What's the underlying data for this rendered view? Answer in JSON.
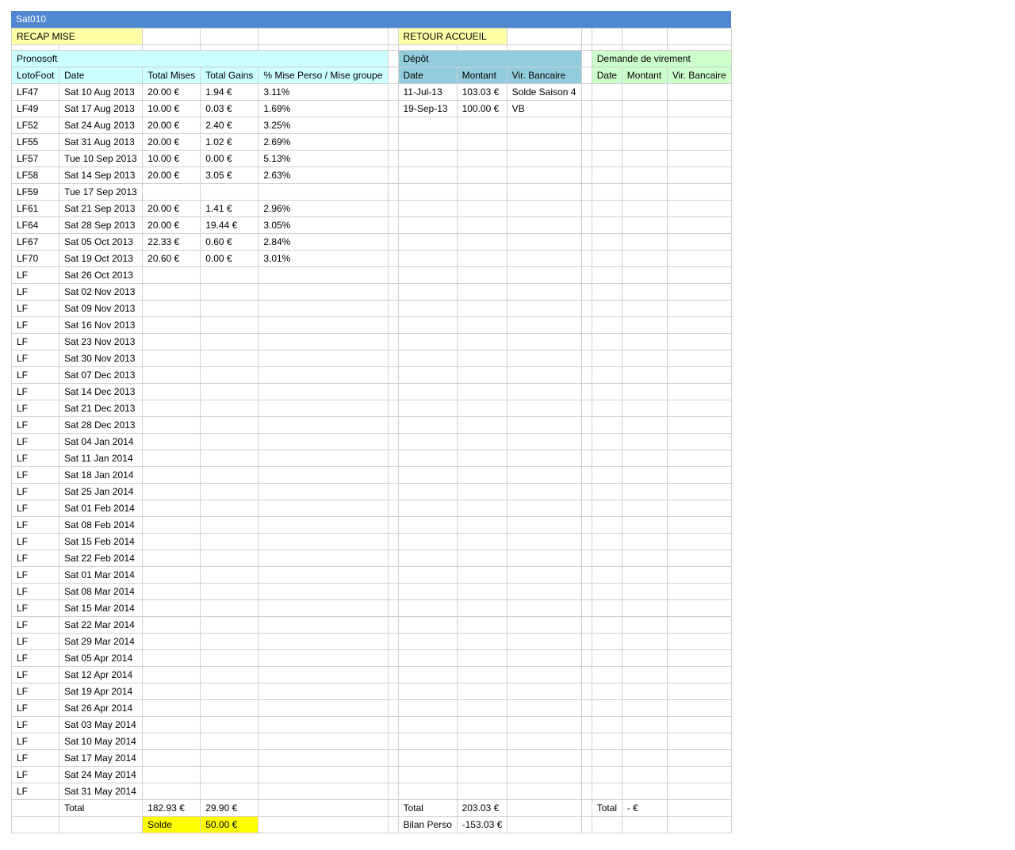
{
  "sheet_title": "Sat010",
  "buttons": {
    "recap_mise": "RECAP MISE",
    "retour_accueil": "RETOUR ACCUEIL"
  },
  "pronosoft": {
    "section_title": "Pronosoft",
    "headers": {
      "lotofoot": "LotoFoot",
      "date": "Date",
      "total_mises": "Total Mises",
      "total_gains": "Total Gains",
      "pct": "% Mise Perso / Mise groupe"
    },
    "rows": [
      [
        "LF47",
        "Sat 10 Aug 2013",
        "20.00 €",
        "1.94 €",
        "3.11%"
      ],
      [
        "LF49",
        "Sat 17 Aug 2013",
        "10.00 €",
        "0.03 €",
        "1.69%"
      ],
      [
        "LF52",
        "Sat 24 Aug 2013",
        "20.00 €",
        "2.40 €",
        "3.25%"
      ],
      [
        "LF55",
        "Sat 31 Aug 2013",
        "20.00 €",
        "1.02 €",
        "2.69%"
      ],
      [
        "LF57",
        "Tue 10 Sep 2013",
        "10.00 €",
        "0.00 €",
        "5.13%"
      ],
      [
        "LF58",
        "Sat 14 Sep 2013",
        "20.00 €",
        "3.05 €",
        "2.63%"
      ],
      [
        "LF59",
        "Tue 17 Sep 2013",
        "",
        "",
        ""
      ],
      [
        "LF61",
        "Sat 21 Sep 2013",
        "20.00 €",
        "1.41 €",
        "2.96%"
      ],
      [
        "LF64",
        "Sat 28 Sep 2013",
        "20.00 €",
        "19.44 €",
        "3.05%"
      ],
      [
        "LF67",
        "Sat 05 Oct 2013",
        "22.33 €",
        "0.60 €",
        "2.84%"
      ],
      [
        "LF70",
        "Sat 19 Oct 2013",
        "20.60 €",
        "0.00 €",
        "3.01%"
      ],
      [
        "LF",
        "Sat 26 Oct 2013",
        "",
        "",
        ""
      ],
      [
        "LF",
        "Sat 02 Nov 2013",
        "",
        "",
        ""
      ],
      [
        "LF",
        "Sat 09 Nov 2013",
        "",
        "",
        ""
      ],
      [
        "LF",
        "Sat 16 Nov 2013",
        "",
        "",
        ""
      ],
      [
        "LF",
        "Sat 23 Nov 2013",
        "",
        "",
        ""
      ],
      [
        "LF",
        "Sat 30 Nov 2013",
        "",
        "",
        ""
      ],
      [
        "LF",
        "Sat 07 Dec 2013",
        "",
        "",
        ""
      ],
      [
        "LF",
        "Sat 14 Dec 2013",
        "",
        "",
        ""
      ],
      [
        "LF",
        "Sat 21 Dec 2013",
        "",
        "",
        ""
      ],
      [
        "LF",
        "Sat 28 Dec 2013",
        "",
        "",
        ""
      ],
      [
        "LF",
        "Sat 04 Jan 2014",
        "",
        "",
        ""
      ],
      [
        "LF",
        "Sat 11 Jan 2014",
        "",
        "",
        ""
      ],
      [
        "LF",
        "Sat 18 Jan 2014",
        "",
        "",
        ""
      ],
      [
        "LF",
        "Sat 25 Jan 2014",
        "",
        "",
        ""
      ],
      [
        "LF",
        "Sat 01 Feb 2014",
        "",
        "",
        ""
      ],
      [
        "LF",
        "Sat 08 Feb 2014",
        "",
        "",
        ""
      ],
      [
        "LF",
        "Sat 15 Feb 2014",
        "",
        "",
        ""
      ],
      [
        "LF",
        "Sat 22 Feb 2014",
        "",
        "",
        ""
      ],
      [
        "LF",
        "Sat 01 Mar 2014",
        "",
        "",
        ""
      ],
      [
        "LF",
        "Sat 08 Mar 2014",
        "",
        "",
        ""
      ],
      [
        "LF",
        "Sat 15 Mar 2014",
        "",
        "",
        ""
      ],
      [
        "LF",
        "Sat 22 Mar 2014",
        "",
        "",
        ""
      ],
      [
        "LF",
        "Sat 29 Mar 2014",
        "",
        "",
        ""
      ],
      [
        "LF",
        "Sat 05 Apr 2014",
        "",
        "",
        ""
      ],
      [
        "LF",
        "Sat 12 Apr 2014",
        "",
        "",
        ""
      ],
      [
        "LF",
        "Sat 19 Apr 2014",
        "",
        "",
        ""
      ],
      [
        "LF",
        "Sat 26 Apr 2014",
        "",
        "",
        ""
      ],
      [
        "LF",
        "Sat 03 May 2014",
        "",
        "",
        ""
      ],
      [
        "LF",
        "Sat 10 May 2014",
        "",
        "",
        ""
      ],
      [
        "LF",
        "Sat 17 May 2014",
        "",
        "",
        ""
      ],
      [
        "LF",
        "Sat 24 May 2014",
        "",
        "",
        ""
      ],
      [
        "LF",
        "Sat 31 May 2014",
        "",
        "",
        ""
      ]
    ],
    "total_label": "Total",
    "total_mises": "182.93 €",
    "total_gains": "29.90 €",
    "solde_label": "Solde",
    "solde_value": "50.00 €"
  },
  "depot": {
    "section_title": "Dépôt",
    "headers": {
      "date": "Date",
      "montant": "Montant",
      "vir": "Vir. Bancaire"
    },
    "rows": [
      [
        "11-Jul-13",
        "103.03 €",
        "Solde Saison 4"
      ],
      [
        "19-Sep-13",
        "100.00 €",
        "VB"
      ]
    ],
    "total_label": "Total",
    "total_value": "203.03 €",
    "bilan_label": "Bilan Perso",
    "bilan_value": "-153.03 €"
  },
  "virement": {
    "section_title": "Demande de virement",
    "headers": {
      "date": "Date",
      "montant": "Montant",
      "vir": "Vir. Bancaire"
    },
    "rows": [],
    "total_label": "Total",
    "total_value": "- €"
  },
  "colors": {
    "title_bar": "#4f87d1",
    "recap_bg": "#ffffa8",
    "pronosoft_bg": "#ccffff",
    "depot_bg": "#93cddd",
    "virement_bg": "#ccffcc",
    "solde_bg": "#ffff00",
    "grid": "#cfcfcf"
  }
}
